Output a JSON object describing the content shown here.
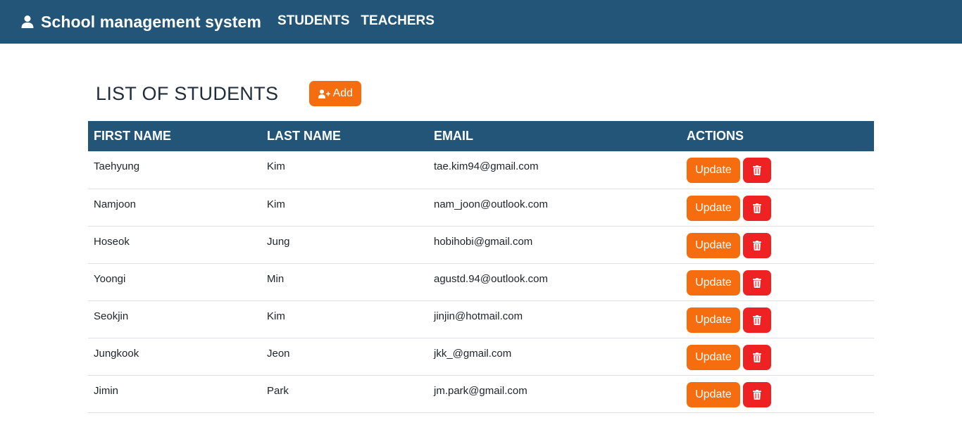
{
  "navbar": {
    "brand_title": "School management system",
    "brand_icon": "user-icon",
    "links": [
      "STUDENTS",
      "TEACHERS"
    ],
    "background": "#235578"
  },
  "page": {
    "title": "LIST OF STUDENTS",
    "add_label": "Add",
    "add_icon": "user-plus-icon"
  },
  "table": {
    "headers": [
      "FIRST NAME",
      "LAST NAME",
      "EMAIL",
      "ACTIONS"
    ],
    "update_label": "Update",
    "delete_icon": "trash-icon",
    "rows": [
      {
        "first": "Taehyung",
        "last": "Kim",
        "email": "tae.kim94@gmail.com"
      },
      {
        "first": "Namjoon",
        "last": "Kim",
        "email": "nam_joon@outlook.com"
      },
      {
        "first": "Hoseok",
        "last": "Jung",
        "email": "hobihobi@gmail.com"
      },
      {
        "first": "Yoongi",
        "last": "Min",
        "email": "agustd.94@outlook.com"
      },
      {
        "first": "Seokjin",
        "last": "Kim",
        "email": "jinjin@hotmail.com"
      },
      {
        "first": "Jungkook",
        "last": "Jeon",
        "email": "jkk_@gmail.com"
      },
      {
        "first": "Jimin",
        "last": "Park",
        "email": "jm.park@gmail.com"
      }
    ]
  },
  "colors": {
    "primary": "#235578",
    "accent_orange": "#f56d0f",
    "danger_red": "#ee2222"
  }
}
